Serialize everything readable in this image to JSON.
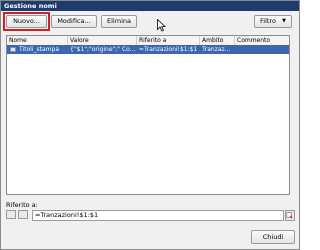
{
  "window": {
    "title": "Gestione nomi"
  },
  "toolbar": {
    "new_label": "Nuovo...",
    "edit_label": "Modifica...",
    "delete_label": "Elimina",
    "filter_label": "Filtro"
  },
  "table": {
    "columns": [
      "Nome",
      "Valore",
      "Riferito a",
      "Ambito",
      "Commento"
    ],
    "rows": [
      {
        "name": "Titoli_stampa",
        "value": "{\"$1\";\"origine\";\" Co...",
        "refers_to": "=Tranzazioni!$1:$1",
        "scope": "Tranzaz...",
        "comment": ""
      }
    ]
  },
  "refers_to": {
    "label": "Riferito a:",
    "value": "=Tranzazioni!$1:$1"
  },
  "footer": {
    "close_label": "Chiudi"
  },
  "colors": {
    "titlebar": "#1f3b6e",
    "selection": "#3d66b0",
    "highlight": "#c8232c"
  }
}
